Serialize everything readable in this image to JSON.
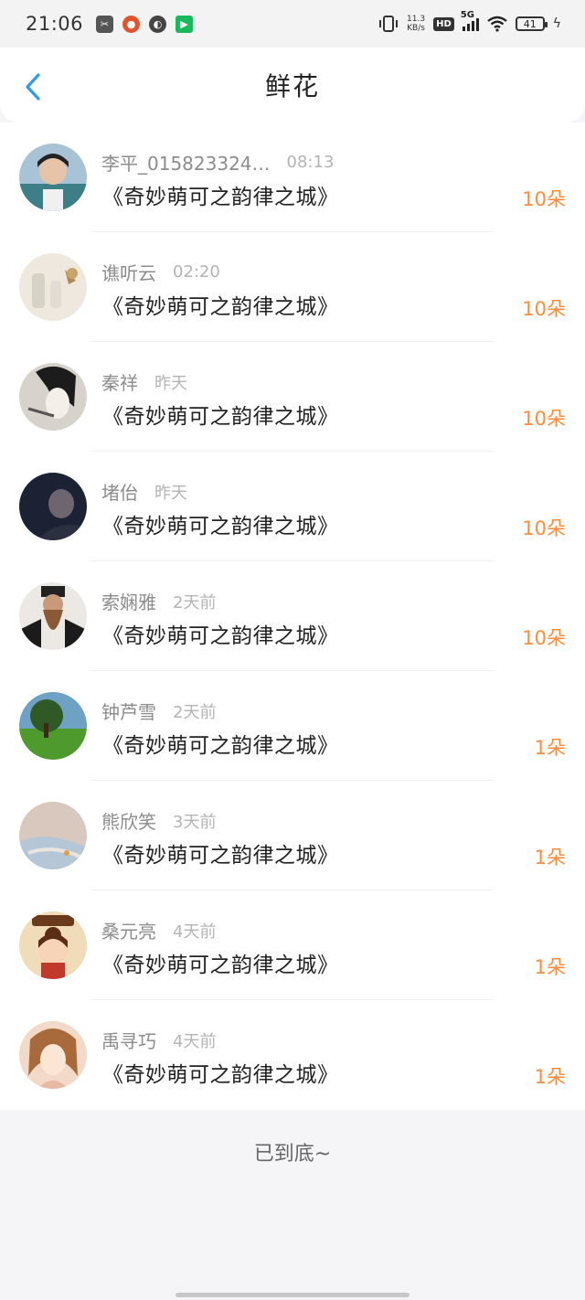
{
  "status_bar": {
    "time": "21:06",
    "net_speed_value": "11.3",
    "net_speed_unit": "KB/s",
    "hd_label": "HD",
    "network_label": "5G",
    "battery_level": "41"
  },
  "header": {
    "title": "鲜花",
    "back_icon": "chevron-left-icon"
  },
  "colors": {
    "accent": "#2f9be8",
    "amount": "#ff8c3c",
    "name": "#8c8c8c",
    "time": "#b4b4b4"
  },
  "records": [
    {
      "name": "李平_015823324…",
      "time": "08:13",
      "book": "《奇妙萌可之韵律之城》",
      "amount": "10朵",
      "avatar": "avatar-photo"
    },
    {
      "name": "谯听云",
      "time": "02:20",
      "book": "《奇妙萌可之韵律之城》",
      "amount": "10朵",
      "avatar": "avatar-photo"
    },
    {
      "name": "秦祥",
      "time": "昨天",
      "book": "《奇妙萌可之韵律之城》",
      "amount": "10朵",
      "avatar": "avatar-photo"
    },
    {
      "name": "堵佁",
      "time": "昨天",
      "book": "《奇妙萌可之韵律之城》",
      "amount": "10朵",
      "avatar": "avatar-photo"
    },
    {
      "name": "索娴雅",
      "time": "2天前",
      "book": "《奇妙萌可之韵律之城》",
      "amount": "10朵",
      "avatar": "avatar-photo"
    },
    {
      "name": "钟芦雪",
      "time": "2天前",
      "book": "《奇妙萌可之韵律之城》",
      "amount": "1朵",
      "avatar": "avatar-photo"
    },
    {
      "name": "熊欣笑",
      "time": "3天前",
      "book": "《奇妙萌可之韵律之城》",
      "amount": "1朵",
      "avatar": "avatar-photo"
    },
    {
      "name": "桑元亮",
      "time": "4天前",
      "book": "《奇妙萌可之韵律之城》",
      "amount": "1朵",
      "avatar": "avatar-photo"
    },
    {
      "name": "禹寻巧",
      "time": "4天前",
      "book": "《奇妙萌可之韵律之城》",
      "amount": "1朵",
      "avatar": "avatar-photo"
    }
  ],
  "footer": {
    "end_text": "已到底~"
  }
}
